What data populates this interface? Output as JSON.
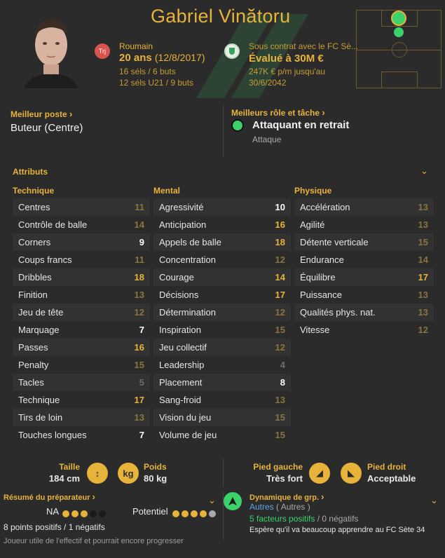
{
  "player": {
    "name": "Gabriel Vinătoru",
    "nationality": "Roumain",
    "flag_code": "Trj",
    "age": "20 ans",
    "dob": "(12/8/2017)",
    "caps": "16 séls / 6 buts",
    "u21_caps": "12 séls U21 / 9 buts",
    "contract": "Sous contrat avec le FC Sè...",
    "value": "Évalué à 30M €",
    "wage": "247K € p/m jusqu'au",
    "contract_end": "30/6/2042"
  },
  "best_position": {
    "label": "Meilleur poste",
    "value": "Buteur (Centre)"
  },
  "best_role": {
    "label": "Meilleurs rôle et tâche",
    "role": "Attaquant en retrait",
    "duty": "Attaque"
  },
  "attributes": {
    "title": "Attributs",
    "technique": {
      "heading": "Technique",
      "rows": [
        {
          "name": "Centres",
          "value": "11",
          "tier": "mid"
        },
        {
          "name": "Contrôle de balle",
          "value": "14",
          "tier": "mid"
        },
        {
          "name": "Corners",
          "value": "9",
          "tier": "white"
        },
        {
          "name": "Coups francs",
          "value": "11",
          "tier": "mid"
        },
        {
          "name": "Dribbles",
          "value": "18",
          "tier": "hi"
        },
        {
          "name": "Finition",
          "value": "13",
          "tier": "mid"
        },
        {
          "name": "Jeu de tête",
          "value": "12",
          "tier": "mid"
        },
        {
          "name": "Marquage",
          "value": "7",
          "tier": "white"
        },
        {
          "name": "Passes",
          "value": "16",
          "tier": "hi"
        },
        {
          "name": "Penalty",
          "value": "15",
          "tier": "mid"
        },
        {
          "name": "Tacles",
          "value": "5",
          "tier": "lo"
        },
        {
          "name": "Technique",
          "value": "17",
          "tier": "hi"
        },
        {
          "name": "Tirs de loin",
          "value": "13",
          "tier": "mid"
        },
        {
          "name": "Touches longues",
          "value": "7",
          "tier": "white"
        }
      ]
    },
    "mental": {
      "heading": "Mental",
      "rows": [
        {
          "name": "Agressivité",
          "value": "10",
          "tier": "white"
        },
        {
          "name": "Anticipation",
          "value": "16",
          "tier": "hi"
        },
        {
          "name": "Appels de balle",
          "value": "18",
          "tier": "hi"
        },
        {
          "name": "Concentration",
          "value": "12",
          "tier": "mid"
        },
        {
          "name": "Courage",
          "value": "14",
          "tier": "hi"
        },
        {
          "name": "Décisions",
          "value": "17",
          "tier": "hi"
        },
        {
          "name": "Détermination",
          "value": "12",
          "tier": "mid"
        },
        {
          "name": "Inspiration",
          "value": "15",
          "tier": "mid"
        },
        {
          "name": "Jeu collectif",
          "value": "12",
          "tier": "mid"
        },
        {
          "name": "Leadership",
          "value": "4",
          "tier": "lo"
        },
        {
          "name": "Placement",
          "value": "8",
          "tier": "white"
        },
        {
          "name": "Sang-froid",
          "value": "13",
          "tier": "mid"
        },
        {
          "name": "Vision du jeu",
          "value": "15",
          "tier": "mid"
        },
        {
          "name": "Volume de jeu",
          "value": "15",
          "tier": "mid"
        }
      ]
    },
    "physique": {
      "heading": "Physique",
      "rows": [
        {
          "name": "Accélération",
          "value": "13",
          "tier": "mid"
        },
        {
          "name": "Agilité",
          "value": "13",
          "tier": "mid"
        },
        {
          "name": "Détente verticale",
          "value": "15",
          "tier": "mid"
        },
        {
          "name": "Endurance",
          "value": "14",
          "tier": "mid"
        },
        {
          "name": "Équilibre",
          "value": "17",
          "tier": "hi"
        },
        {
          "name": "Puissance",
          "value": "13",
          "tier": "mid"
        },
        {
          "name": "Qualités phys. nat.",
          "value": "13",
          "tier": "mid"
        },
        {
          "name": "Vitesse",
          "value": "12",
          "tier": "mid"
        }
      ]
    }
  },
  "physical": {
    "height_label": "Taille",
    "height": "184 cm",
    "weight_label": "Poids",
    "weight": "80 kg",
    "left_foot_label": "Pied gauche",
    "left_foot": "Très fort",
    "right_foot_label": "Pied droit",
    "right_foot": "Acceptable"
  },
  "coach_report": {
    "title": "Résumé du préparateur",
    "ca_label": "NA",
    "ca_stars": 3,
    "pa_label": "Potentiel",
    "pa_stars": 4,
    "points": "8 points positifs / 1 négatifs",
    "summary": "Joueur utile de l'effectif et pourrait encore progresser"
  },
  "dynamics": {
    "title": "Dynamique de grp.",
    "group": "Autres",
    "group_sub": "( Autres )",
    "positives": "5 facteurs positifs",
    "negatives": "0 négatifs",
    "note": "Espère qu'il va beaucoup apprendre au FC Sète 34"
  },
  "colors": {
    "accent": "#e8b33a",
    "background": "#2b2b2b",
    "position_dot": "#3cd16a"
  }
}
